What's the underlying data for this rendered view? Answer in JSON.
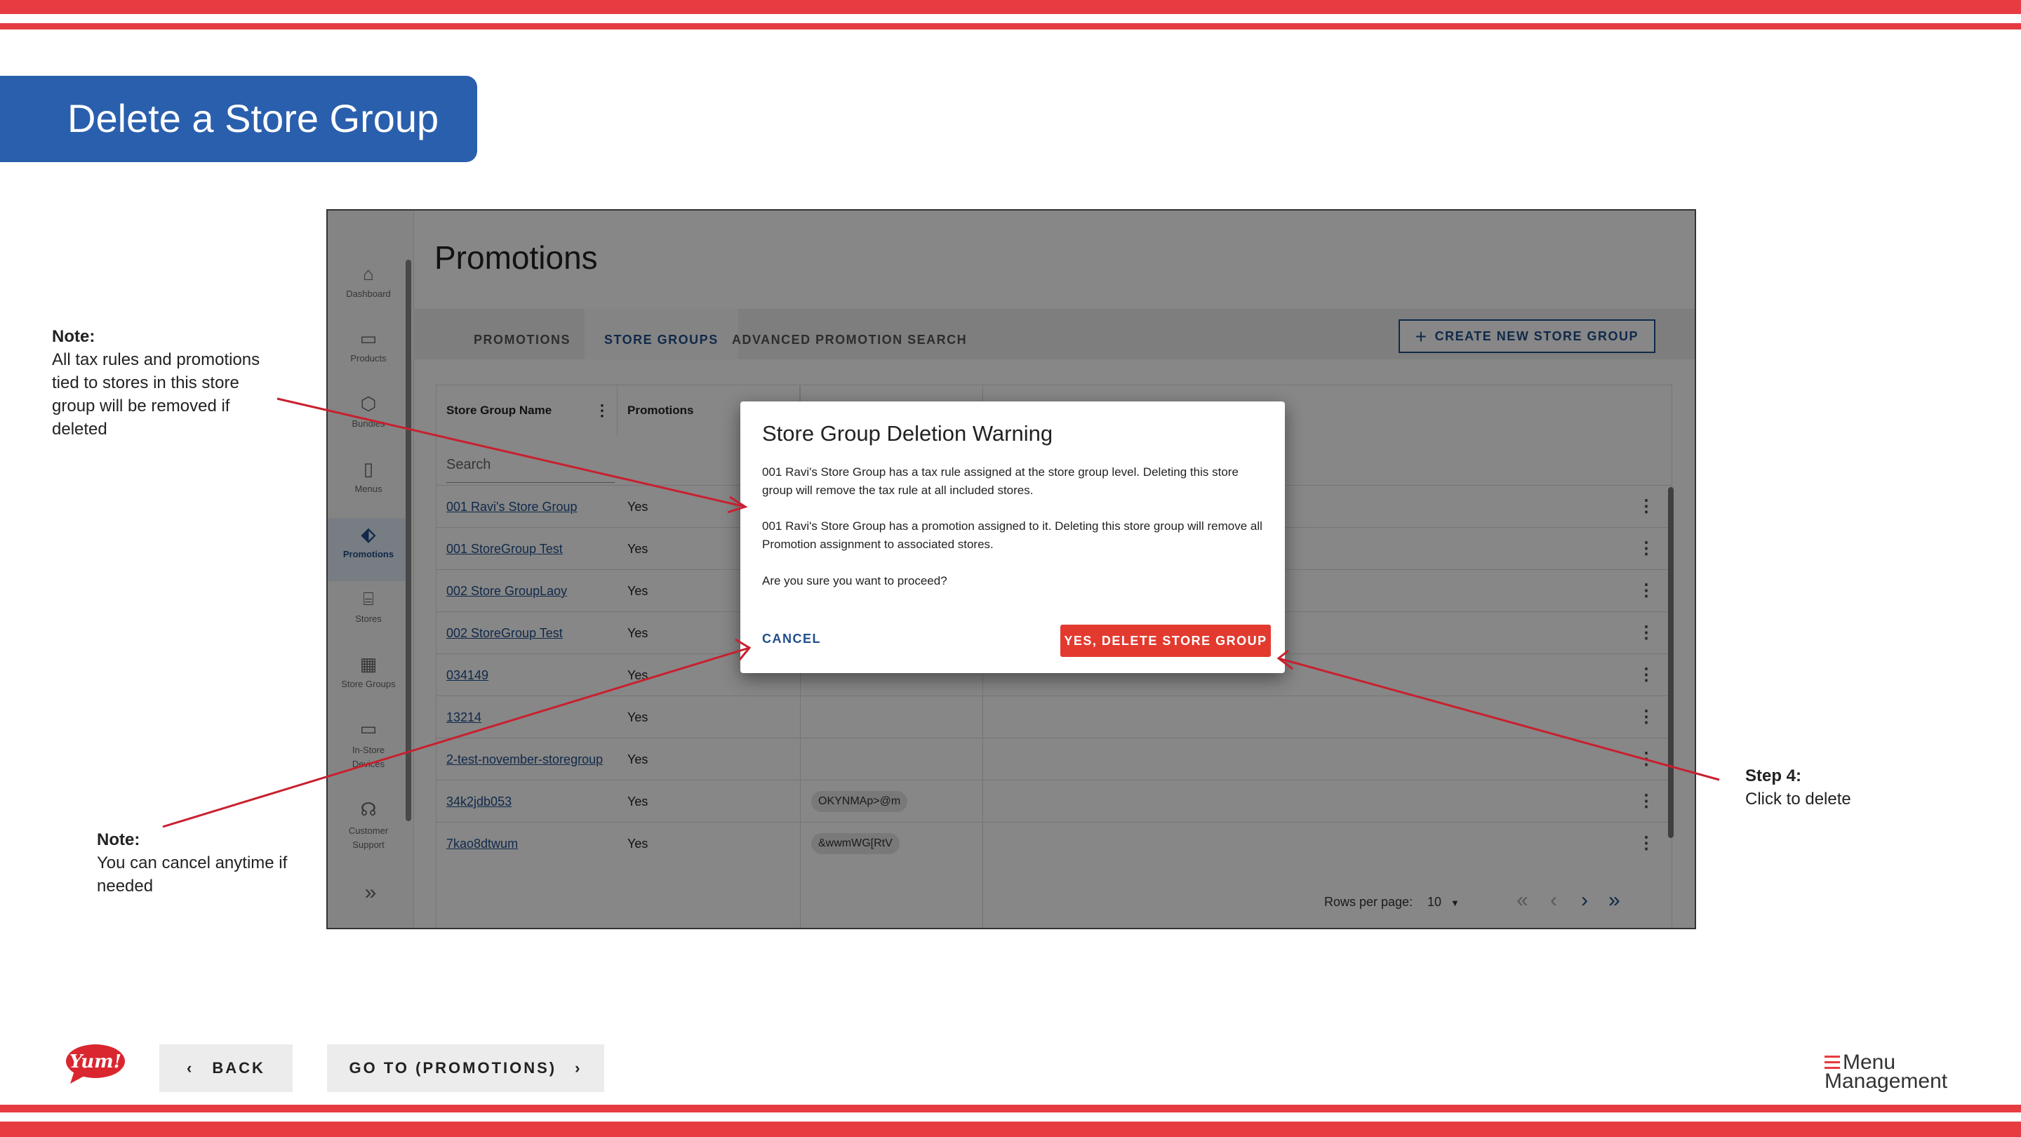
{
  "slide": {
    "title": "Delete a Store Group",
    "note_top": {
      "heading": "Note:",
      "text": "All tax rules and promotions tied to stores in this store group will be removed if deleted"
    },
    "note_bottom": {
      "heading": "Note:",
      "text": "You can cancel anytime if needed"
    },
    "step": {
      "heading": "Step 4:",
      "text": "Click to delete"
    },
    "back_label": "BACK",
    "goto_label": "GO TO (PROMOTIONS)",
    "brand_logo": "Yum!",
    "app_logo_line1": "Menu",
    "app_logo_line2": "Management",
    "colors": {
      "stripe": "#e63c41",
      "title_bg": "#2a5fad",
      "accent": "#1f4e8c",
      "danger": "#e33a2f"
    }
  },
  "app": {
    "sidebar": [
      {
        "label": "Dashboard",
        "icon": "home-icon"
      },
      {
        "label": "Products",
        "icon": "box-icon"
      },
      {
        "label": "Bundles",
        "icon": "cube-icon"
      },
      {
        "label": "Menus",
        "icon": "document-icon"
      },
      {
        "label": "Promotions",
        "icon": "tag-icon"
      },
      {
        "label": "Stores",
        "icon": "store-icon"
      },
      {
        "label": "Store Groups",
        "icon": "grid-icon"
      },
      {
        "label": "In-Store Devices",
        "icon": "monitor-icon"
      },
      {
        "label": "Customer Support",
        "icon": "headset-icon"
      }
    ],
    "page_title": "Promotions",
    "tabs": [
      "PROMOTIONS",
      "STORE GROUPS",
      "ADVANCED PROMOTION SEARCH"
    ],
    "create_button": "CREATE NEW STORE GROUP",
    "table": {
      "columns": [
        "Store Group Name",
        "Promotions"
      ],
      "search_placeholder": "Search",
      "rows": [
        {
          "name": "001 Ravi's Store Group",
          "promotions": "Yes",
          "tag": ""
        },
        {
          "name": "001 StoreGroup Test",
          "promotions": "Yes",
          "tag": ""
        },
        {
          "name": "002 Store GroupLaoy",
          "promotions": "Yes",
          "tag": ""
        },
        {
          "name": "002 StoreGroup Test",
          "promotions": "Yes",
          "tag": ""
        },
        {
          "name": "034149",
          "promotions": "Yes",
          "tag": ""
        },
        {
          "name": "13214",
          "promotions": "Yes",
          "tag": ""
        },
        {
          "name": "2-test-november-storegroup",
          "promotions": "Yes",
          "tag": ""
        },
        {
          "name": "34k2jdb053",
          "promotions": "Yes",
          "tag": "OKYNMAp>@m"
        },
        {
          "name": "7kao8dtwum",
          "promotions": "Yes",
          "tag": "&wwmWG[RtV"
        }
      ]
    },
    "pagination": {
      "rows_per_page_label": "Rows per page:",
      "rows_per_page": "10"
    },
    "dialog": {
      "title": "Store Group Deletion Warning",
      "para1": "001 Ravi's Store Group has a tax rule assigned at the store group level. Deleting this store group will remove the tax rule at all included stores.",
      "para2": "001 Ravi's Store Group has a promotion assigned to it. Deleting this store group will remove all Promotion assignment to associated stores.",
      "para3": "Are you sure you want to proceed?",
      "cancel": "CANCEL",
      "confirm": "YES, DELETE STORE GROUP"
    }
  }
}
